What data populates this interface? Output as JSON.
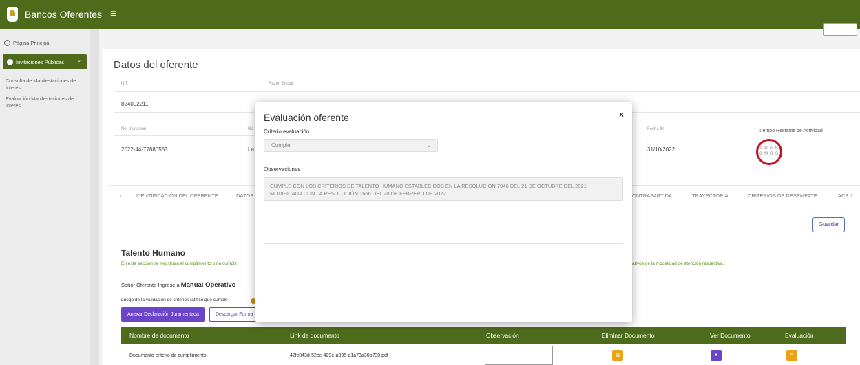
{
  "topbar": {
    "title": "Bancos Oferentes",
    "menu_icon": "≡"
  },
  "sidebar": {
    "home_label": "Página Principal",
    "active_section": "Invitaciones Públicas",
    "links": [
      "Consulta de Manifestaciones de Interés",
      "Evaluación Manifestaciones de Interés"
    ]
  },
  "oferente": {
    "title": "Datos del oferente",
    "nit_label": "NIT",
    "razon_label": "Razón Social",
    "nit_value": "824002211",
    "no_invitacion_label": "No. Invitación",
    "no_invitacion_value": "2022-44-77880553",
    "col2_label_fragment": "Re",
    "col2_value_fragment": "La",
    "fecha_fin_label": "Fecha fin",
    "fecha_fin_value": "31/10/2022",
    "tiempo_label": "Tiempo Restante de Actividad",
    "timer_line1": "0 D 0 H",
    "timer_line2": "0 M 0 S"
  },
  "tabs": {
    "items": [
      "IDENTIFICACIÓN DEL OFERENTE",
      "DATOS",
      "ONTRAPARTIDA",
      "TRAYECTORIA",
      "CRITERIOS DE DESEMPATE",
      "ACE"
    ],
    "prev": "‹",
    "next": "›"
  },
  "actions": {
    "guardar": "Guardar"
  },
  "talento": {
    "title": "Talento Humano",
    "note_left": "En esta sección se registrará el cumplimiento o no cumplir",
    "note_right": "ativos de la modalidad de atención respectiva.",
    "senor_prefix": "Señor Oferente Ingrese a ",
    "senor_link": "Manual Operativo",
    "luego": "Luego de la validación de criterios ratifico que cumplo",
    "anexar": "Anexar Declaración Juramentada",
    "descargar": "Descargar Forma"
  },
  "table": {
    "headers": [
      "Nombre de documento",
      "Link de documento",
      "Observación",
      "Eliminar Documento",
      "Ver Documento",
      "Evaluación"
    ],
    "rows": [
      {
        "nombre": "Documento criterio de cumplimiento",
        "link": "42fc843d-52ce-429e-a095-a1a73a30b730.pdf",
        "observacion": ""
      }
    ]
  },
  "modal": {
    "title": "Evaluación oferente",
    "close": "×",
    "criterio_label": "Criterio evaluación",
    "criterio_value": "Cumple",
    "observaciones_label": "Observaciones",
    "observaciones_value": "CUMPLE CON LOS CRITERIOS DE TALENTO HUMANO ESTABLECIDOS EN LA RESOLUCIÓN 7946 DEL 21 DE OCTUBRE DEL 2021 MODIFICADA CON LA RESOLUCIÓN 1666 DEL 28 DE FEBRERO DE 2022"
  },
  "colors": {
    "brand_green": "#4e6b1c",
    "purple": "#6a45c7",
    "orange": "#e8a317",
    "timer_red": "#c1121f",
    "guardar_blue": "#3d4fa6"
  }
}
